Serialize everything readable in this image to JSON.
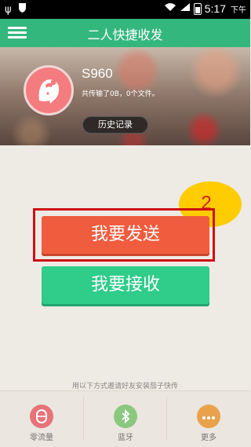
{
  "status_bar": {
    "time": "5:17",
    "time_suffix": "下午",
    "icons": [
      "usb-icon",
      "notification-icon",
      "wifi-icon",
      "signal-icon",
      "battery-icon"
    ]
  },
  "header": {
    "title": "二人快捷收发",
    "menu_icon": "hamburger-menu-icon",
    "bg_color": "#34b77d"
  },
  "device": {
    "name": "S960",
    "summary": "共传输了0B，0个文件。",
    "history_label": "历史记录",
    "avatar_icon": "baby-avatar-icon"
  },
  "annotation": {
    "marker": "2",
    "highlight_color": "#cc1111"
  },
  "actions": {
    "send_label": "我要发送",
    "receive_label": "我要接收",
    "send_color": "#f05c3e",
    "receive_color": "#2fcc8a"
  },
  "invite": {
    "text": "用以下方式邀请好友安装茄子快传",
    "options": [
      {
        "label": "零流量",
        "icon": "zero-data-icon",
        "color": "#e8727a"
      },
      {
        "label": "蓝牙",
        "icon": "bluetooth-icon",
        "color": "#8bc87f"
      },
      {
        "label": "更多",
        "icon": "more-icon",
        "color": "#e9a24c"
      }
    ]
  }
}
